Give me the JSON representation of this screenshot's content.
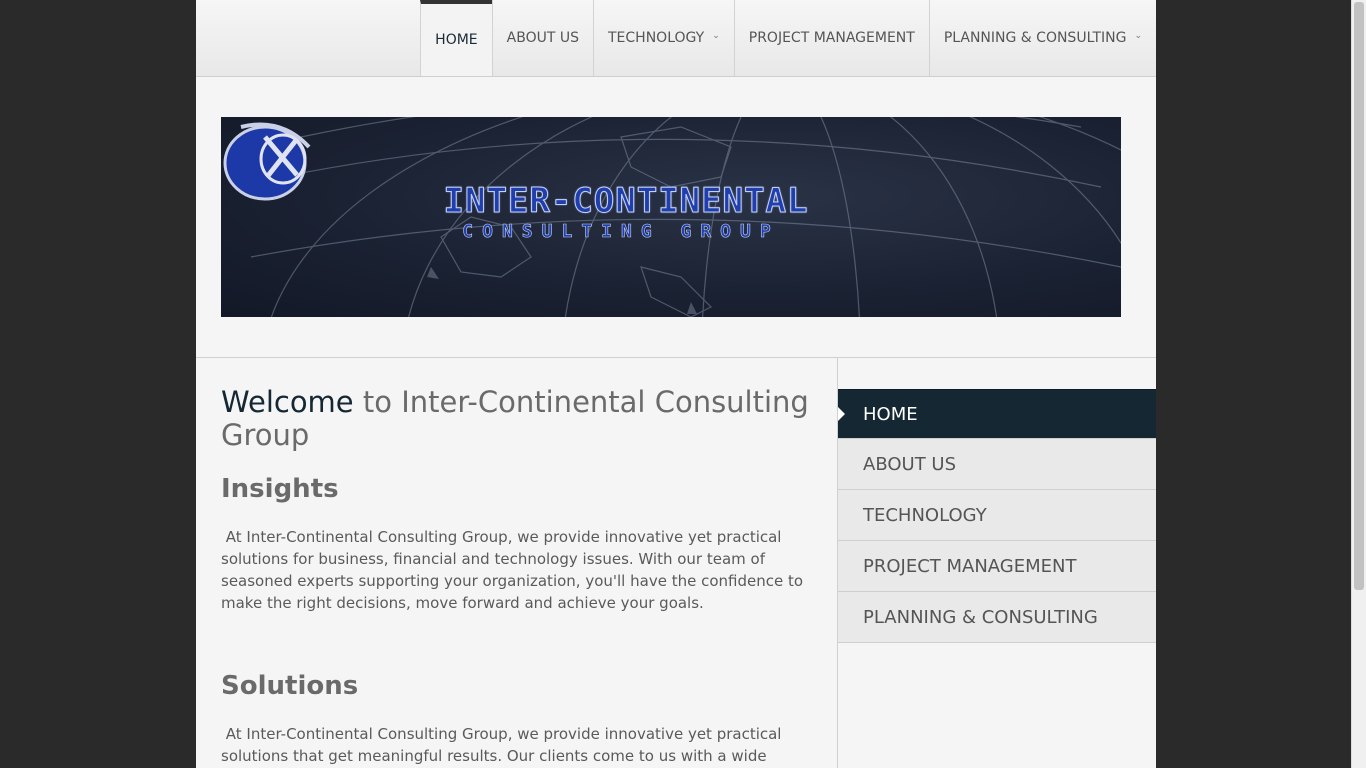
{
  "topnav": {
    "items": [
      {
        "label": "HOME",
        "active": true,
        "has_dropdown": false
      },
      {
        "label": "ABOUT US",
        "active": false,
        "has_dropdown": false
      },
      {
        "label": "TECHNOLOGY",
        "active": false,
        "has_dropdown": true
      },
      {
        "label": "PROJECT MANAGEMENT",
        "active": false,
        "has_dropdown": false
      },
      {
        "label": "PLANNING & CONSULTING",
        "active": false,
        "has_dropdown": true
      }
    ],
    "dropdown_icon": "chevron-down-icon"
  },
  "banner": {
    "title": "INTER-CONTINENTAL",
    "subtitle": "CONSULTING GROUP",
    "logo_icon": "globe-logo-icon"
  },
  "main": {
    "welcome_accent": "Welcome",
    "welcome_rest": " to Inter-Continental Consulting Group",
    "insights_heading": "Insights",
    "insights_text": " At Inter-Continental Consulting Group, we provide innovative yet practical solutions for business, financial and technology issues. With our team of seasoned experts supporting your organization, you'll have the confidence to make the right decisions, move forward and achieve your goals.",
    "solutions_heading": "Solutions",
    "solutions_text": " At Inter-Continental Consulting Group, we provide innovative yet practical solutions that get meaningful results. Our clients come to us with a wide range of"
  },
  "sidebar": {
    "items": [
      {
        "label": "HOME",
        "active": true
      },
      {
        "label": "ABOUT US",
        "active": false
      },
      {
        "label": "TECHNOLOGY",
        "active": false
      },
      {
        "label": "PROJECT MANAGEMENT",
        "active": false
      },
      {
        "label": "PLANNING & CONSULTING",
        "active": false
      }
    ]
  },
  "colors": {
    "accent": "#142733",
    "page_bg": "#f5f5f5",
    "outer_bg": "#2a2a2a",
    "logo_blue": "#1f3fae"
  }
}
